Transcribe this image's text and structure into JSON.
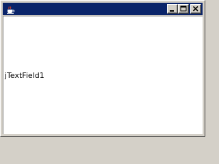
{
  "window": {
    "title": "",
    "app_icon": "java-cup-icon"
  },
  "titlebar_buttons": {
    "minimize_icon": "minimize-icon",
    "maximize_icon": "maximize-icon",
    "close_icon": "close-icon"
  },
  "content": {
    "text_field_value": "jTextField1"
  },
  "colors": {
    "titlebar": "#0a246a",
    "window_face": "#d4d0c8",
    "content_bg": "#ffffff"
  }
}
